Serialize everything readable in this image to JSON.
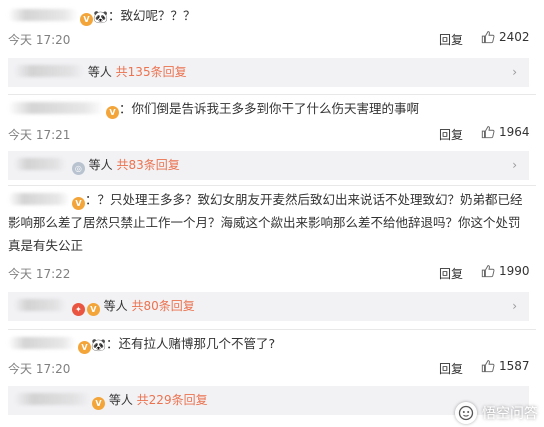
{
  "colors": {
    "count_link": "#eb7350",
    "sub_bar_bg": "#f2f2f5",
    "badge_gold": "#f3a53a",
    "badge_red": "#e95540"
  },
  "icons": {
    "like": "thumbs-up-icon",
    "panda": "panda-emoji-icon",
    "vip": "vip-badge-icon",
    "chevron": "chevron-right-icon"
  },
  "comments": [
    {
      "text": "：致幻呢？？？",
      "time": "今天 17:20",
      "reply_label": "回复",
      "likes": "2402",
      "sub": {
        "who": "等人",
        "count": "共135条回复"
      }
    },
    {
      "text": "：你们倒是告诉我王多多到你干了什么伤天害理的事啊",
      "time": "今天 17:21",
      "reply_label": "回复",
      "likes": "1964",
      "sub": {
        "who": "等人",
        "count": "共83条回复"
      }
    },
    {
      "text": "：？只处理王多多？致幻女朋友开麦然后致幻出来说话不处理致幻？奶弟都已经影响那么差了居然只禁止工作一个月？海威这个歘出来影响那么差不给他辞退吗？你这个处罚真是有失公正",
      "time": "今天 17:22",
      "reply_label": "回复",
      "likes": "1990",
      "sub": {
        "who": "等人",
        "count": "共80条回复"
      }
    },
    {
      "text": "：还有拉人赌博那几个不管了?",
      "time": "今天 17:20",
      "reply_label": "回复",
      "likes": "1587",
      "sub": {
        "who": "等人",
        "count": "共229条回复"
      }
    }
  ],
  "watermark": {
    "text": "悟空问答"
  }
}
